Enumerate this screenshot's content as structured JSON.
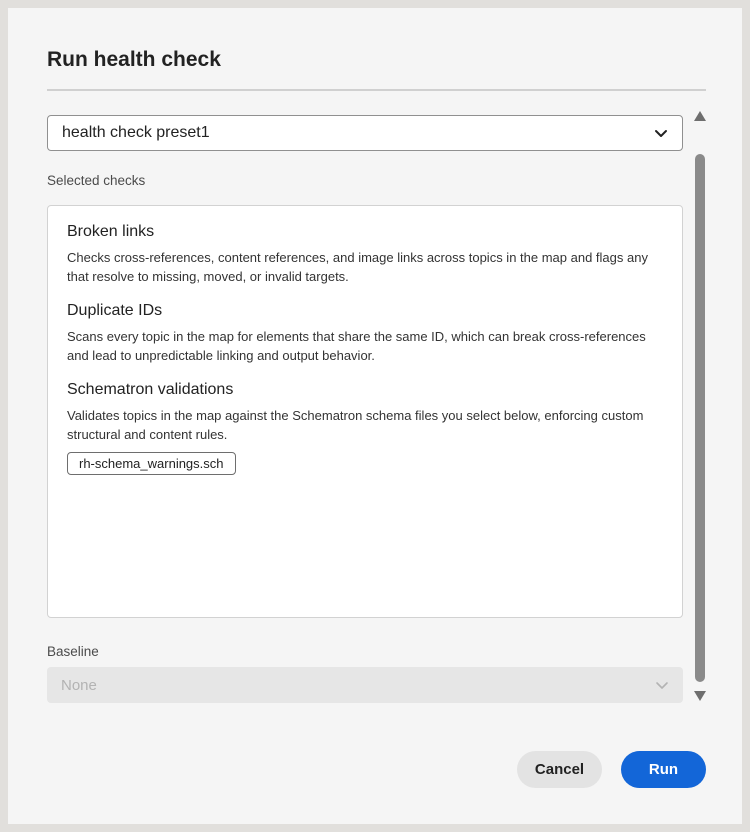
{
  "dialog": {
    "title": "Run health check",
    "preset": {
      "selected": "health check preset1"
    },
    "selected_checks_label": "Selected checks",
    "checks": [
      {
        "name": "Broken links",
        "description": "Checks cross-references, content references, and image links across topics in the map and flags any that resolve to missing, moved, or invalid targets."
      },
      {
        "name": "Duplicate IDs",
        "description": "Scans every topic in the map for elements that share the same ID, which can break cross-references and lead to unpredictable linking and output behavior."
      },
      {
        "name": "Schematron validations",
        "description": "Validates topics in the map against the Schematron schema files you select below, enforcing custom structural and content rules.",
        "files": [
          "rh-schema_warnings.sch"
        ]
      }
    ],
    "baseline_label": "Baseline",
    "baseline": {
      "selected": "None",
      "disabled": true
    },
    "buttons": {
      "cancel": "Cancel",
      "run": "Run"
    }
  },
  "colors": {
    "primary": "#1366d8",
    "scroll_thumb": "#8a8a8a",
    "overlay": "#e1dfdc"
  },
  "icons": {
    "preset_chevron": "chevron-down-icon",
    "baseline_chevron": "chevron-down-icon",
    "scroll_up": "triangle-up-icon",
    "scroll_down": "triangle-down-icon"
  }
}
